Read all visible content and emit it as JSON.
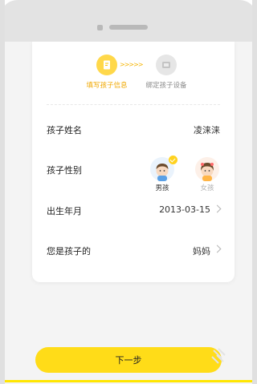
{
  "steps": [
    {
      "label": "填写孩子信息",
      "state": "active",
      "icon": "edit-document-icon"
    },
    {
      "label": "绑定孩子设备",
      "state": "inactive",
      "icon": "device-icon"
    }
  ],
  "step_arrows": ">>>>>",
  "form": {
    "name_label": "孩子姓名",
    "name_value": "凌涞涞",
    "gender_label": "孩子性别",
    "gender_options": [
      {
        "label": "男孩",
        "selected": true
      },
      {
        "label": "女孩",
        "selected": false
      }
    ],
    "birth_label": "出生年月",
    "birth_value": "2013-03-15",
    "relation_label": "您是孩子的",
    "relation_value": "妈妈"
  },
  "next_button": "下一步",
  "colors": {
    "accent": "#ffdc18",
    "active_step_text": "#f0a800"
  }
}
